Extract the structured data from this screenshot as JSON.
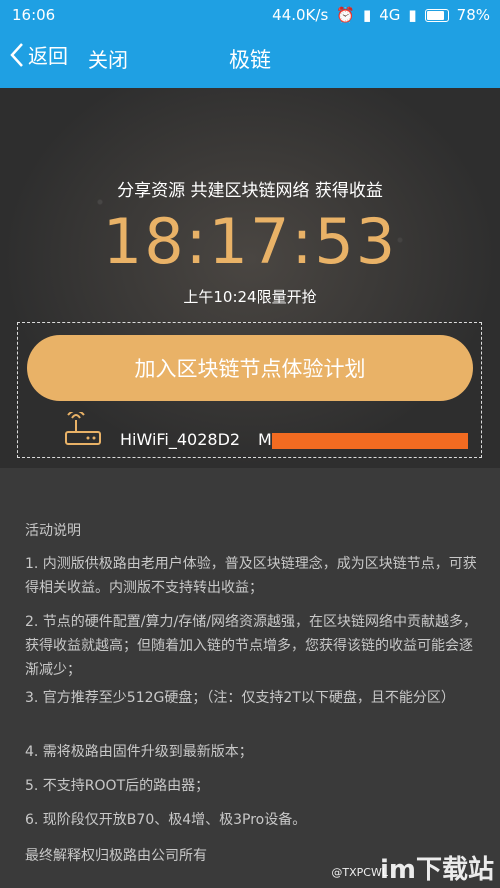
{
  "status_bar": {
    "time": "16:06",
    "speed": "44.0K/s",
    "network": "4G",
    "battery_text": "78%",
    "battery_level": 0.78
  },
  "navbar": {
    "back_label": "返回",
    "close_label": "关闭",
    "title": "极链"
  },
  "hero": {
    "slogan": "分享资源 共建区块链网络 获得收益",
    "clock": "18:17:53",
    "limit_text": "上午10:24限量开抢",
    "join_button": "加入区块链节点体验计划",
    "wifi_name": "HiWiFi_4028D2",
    "mac_prefix": "M"
  },
  "rules": {
    "title": "活动说明",
    "items": [
      "1. 内测版供极路由老用户体验，普及区块链理念，成为区块链节点，可获得相关收益。内测版不支持转出收益；",
      "2. 节点的硬件配置/算力/存储/网络资源越强，在区块链网络中贡献越多，获得收益就越高；但随着加入链的节点增多，您获得该链的收益可能会逐渐减少；",
      "3. 官方推荐至少512G硬盘；（注：仅支持2T以下硬盘，且不能分区）",
      "4. 需将极路由固件升级到最新版本；",
      "5. 不支持ROOT后的路由器；",
      "6. 现阶段仅开放B70、极4增、极3Pro设备。"
    ],
    "footer": "最终解释权归极路由公司所有"
  },
  "watermark": {
    "big": "im下载站",
    "small": "@TXPCWL"
  },
  "colors": {
    "header_blue": "#1fa0e3",
    "gold": "#e9b267",
    "redact_orange": "#f26b21"
  }
}
